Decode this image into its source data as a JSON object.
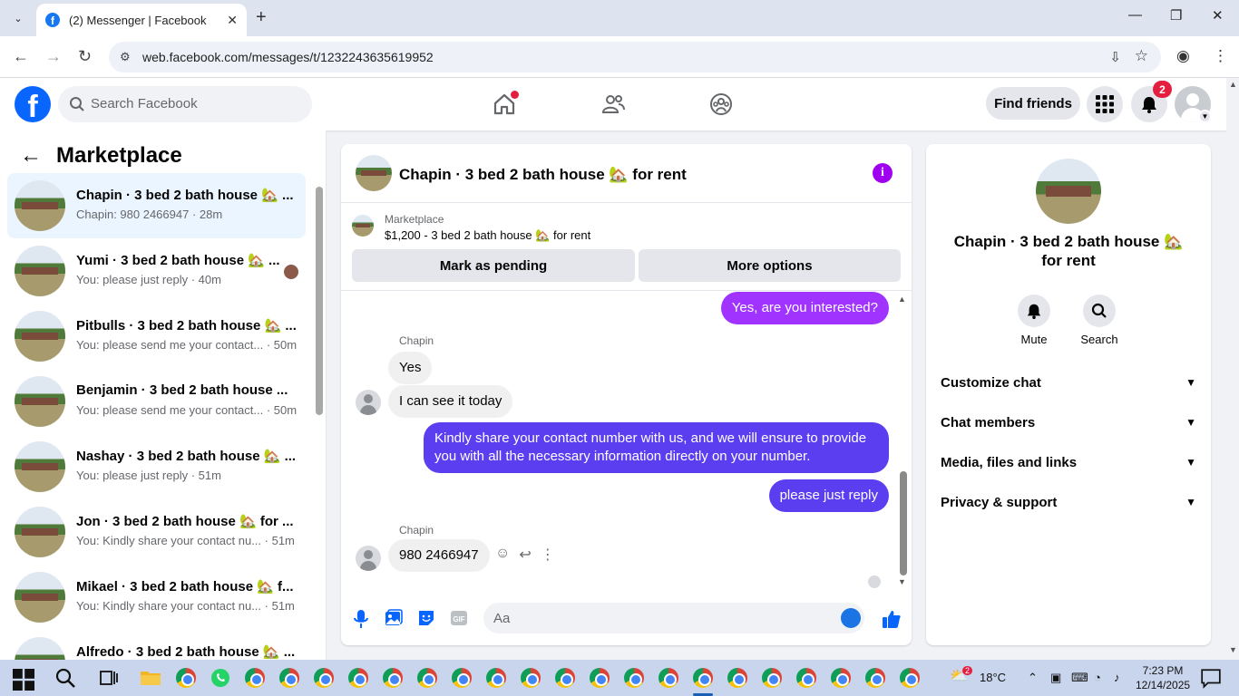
{
  "browser": {
    "tab_title": "(2) Messenger | Facebook",
    "url": "web.facebook.com/messages/t/1232243635619952"
  },
  "fb_header": {
    "search_placeholder": "Search Facebook",
    "find_friends": "Find friends",
    "notification_count": "2"
  },
  "left_panel": {
    "title": "Marketplace",
    "conversations": [
      {
        "name": "Chapin · 3 bed 2 bath house 🏡 ...",
        "preview": "Chapin: 980 2466947 · 28m",
        "active": true
      },
      {
        "name": "Yumi · 3 bed 2 bath house 🏡 ...",
        "preview": "You: please just reply · 40m"
      },
      {
        "name": "Pitbulls · 3 bed 2 bath house 🏡 ...",
        "preview": "You: please send me your contact... · 50m"
      },
      {
        "name": "Benjamin · 3 bed 2 bath house ...",
        "preview": "You: please send me your contact... · 50m"
      },
      {
        "name": "Nashay · 3 bed 2 bath house 🏡 ...",
        "preview": "You: please just reply · 51m"
      },
      {
        "name": "Jon · 3 bed 2 bath house 🏡 for ...",
        "preview": "You: Kindly share your contact nu... · 51m"
      },
      {
        "name": "Mikael · 3 bed 2 bath house 🏡 f...",
        "preview": "You: Kindly share your contact nu... · 51m"
      },
      {
        "name": "Alfredo · 3 bed 2 bath house 🏡 ...",
        "preview": ""
      }
    ]
  },
  "chat": {
    "title": "Chapin · 3 bed 2 bath house 🏡 for rent",
    "marketplace_label": "Marketplace",
    "listing": "$1,200 - 3 bed 2 bath house 🏡 for rent",
    "mark_pending": "Mark as pending",
    "more_options": "More options",
    "messages": {
      "m1": "Yes, are you interested?",
      "sender1": "Chapin",
      "m2": "Yes",
      "m3": "I can see it today",
      "m4": "Kindly share your contact number with us, and we will ensure to provide you with all the necessary information directly on your number.",
      "m5": "please just reply",
      "sender2": "Chapin",
      "m6": "980 2466947"
    },
    "composer_placeholder": "Aa"
  },
  "right_panel": {
    "title": "Chapin · 3 bed 2 bath house 🏡 for rent",
    "mute": "Mute",
    "search": "Search",
    "sections": [
      "Customize chat",
      "Chat members",
      "Media, files and links",
      "Privacy & support"
    ]
  },
  "taskbar": {
    "temperature": "18°C",
    "time": "7:23 PM",
    "date": "12/14/2025",
    "weather_badge": "2"
  },
  "colors": {
    "fb_blue": "#0866ff",
    "messenger_purple": "#a033ff",
    "messenger_blue": "#5b3ef0",
    "notification_red": "#e41e3f"
  }
}
